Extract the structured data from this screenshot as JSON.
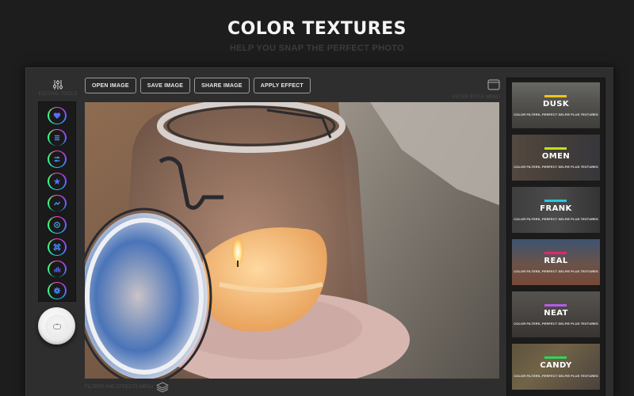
{
  "hero": {
    "title": "COLOR TEXTURES",
    "subtitle": "HELP YOU SNAP THE PERFECT PHOTO"
  },
  "sidebar": {
    "header_icon": "sliders-icon",
    "label": "EDITING TOOLS",
    "tools": [
      {
        "name": "favorites",
        "icon": "heart-icon"
      },
      {
        "name": "list",
        "icon": "list-icon"
      },
      {
        "name": "adjust",
        "icon": "sliders-icon"
      },
      {
        "name": "effects",
        "icon": "star-icon"
      },
      {
        "name": "curves",
        "icon": "wave-icon"
      },
      {
        "name": "focus",
        "icon": "target-icon"
      },
      {
        "name": "transform",
        "icon": "command-icon"
      },
      {
        "name": "levels",
        "icon": "bar-chart-icon"
      },
      {
        "name": "settings",
        "icon": "gear-icon"
      }
    ],
    "power_icon": "toggle-icon"
  },
  "toolbar": {
    "open_label": "OPEN IMAGE",
    "save_label": "SAVE IMAGE",
    "share_label": "SHARE IMAGE",
    "apply_label": "APPLY EFFECT"
  },
  "filter_style_menu": {
    "label": "FILTER STYLE MENU",
    "icon": "window-icon"
  },
  "filters_menu": {
    "label": "FILTERS AND EFFECTS MENU",
    "icon": "layers-icon"
  },
  "colors": {
    "background": "#1d1d1d",
    "window": "#2e2e2e",
    "panel": "#1b1b1b"
  },
  "filters": [
    {
      "name": "DUSK",
      "subtitle": "COLOR FILTERS, PERFECT SELFIE PLUS TEXTURES",
      "accent": "#f2c21b",
      "selected": true
    },
    {
      "name": "OMEN",
      "subtitle": "COLOR FILTERS, PERFECT SELFIE PLUS TEXTURES",
      "accent": "#b8e61b",
      "selected": false
    },
    {
      "name": "FRANK",
      "subtitle": "COLOR FILTERS, PERFECT SELFIE PLUS TEXTURES",
      "accent": "#24c8e0",
      "selected": false
    },
    {
      "name": "REAL",
      "subtitle": "COLOR FILTERS, PERFECT SELFIE PLUS TEXTURES",
      "accent": "#e8256e",
      "selected": false
    },
    {
      "name": "NEAT",
      "subtitle": "COLOR FILTERS, PERFECT SELFIE PLUS TEXTURES",
      "accent": "#b35ce6",
      "selected": false
    },
    {
      "name": "CANDY",
      "subtitle": "COLOR FILTERS, PERFECT SELFIE PLUS TEXTURES",
      "accent": "#2bd65a",
      "selected": false
    }
  ]
}
